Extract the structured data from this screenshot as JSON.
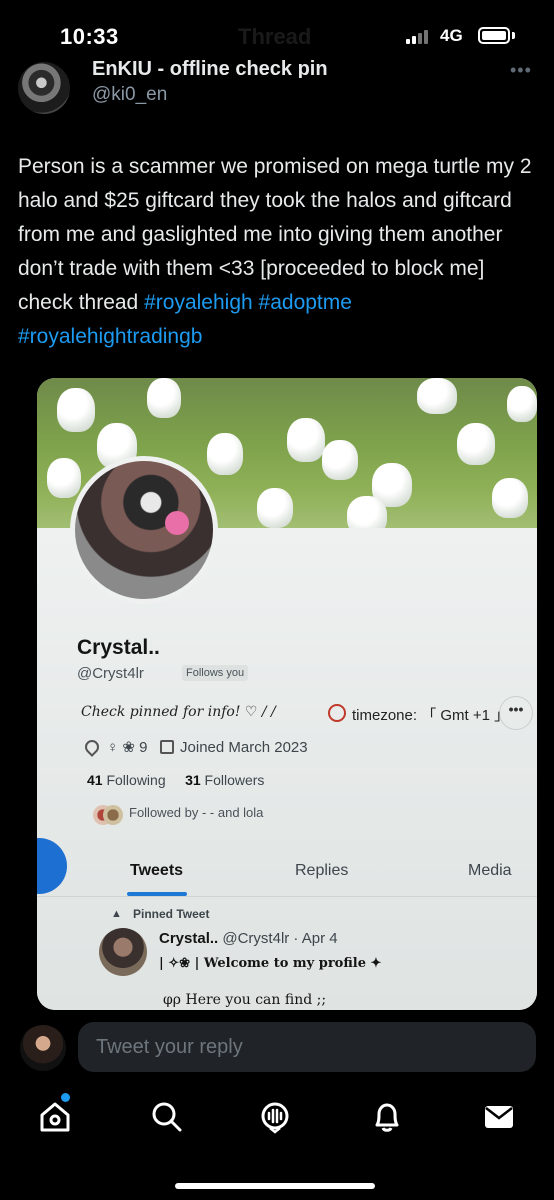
{
  "status_bar": {
    "time": "10:33",
    "network": "4G",
    "ghost_title": "Thread"
  },
  "author": {
    "name": "EnKIU - offline check pin",
    "handle": "@ki0_en",
    "more": "•••"
  },
  "tweet": {
    "text": "Person is a scammer we promised on mega turtle  my 2 halo and $25 giftcard they took the halos and giftcard from me and gaslighted me into giving them another don’t trade with them <33 [proceeded to block me] check thread",
    "hashtags": [
      "#royalehigh",
      "#adoptme",
      "#royalehightradingb"
    ]
  },
  "photo": {
    "profile_name": "Crystal..",
    "profile_handle": "@Cryst4lr",
    "follows_you": "Follows you",
    "bio": "Check pinned for info! ♡ / /",
    "timezone": "timezone: 「 Gmt +1 」",
    "meta_icons": "♀ ❀ 9",
    "joined": "Joined March 2023",
    "following_count": "41",
    "following_label": "Following",
    "followers_count": "31",
    "followers_label": "Followers",
    "followed_by": "Followed by - - and lola",
    "more": "•••",
    "tabs": [
      "Tweets",
      "Replies",
      "Media"
    ],
    "pinned_label": "Pinned Tweet",
    "pinned_name": "Crystal..",
    "pinned_meta": "@Cryst4lr · Apr 4",
    "pinned_line1": "| ✧❀ | Welcome to my profile ✦",
    "pinned_line2": "φρ Here you can find ;;"
  },
  "reply": {
    "placeholder": "Tweet your reply"
  },
  "nav": {
    "icons": [
      "home-icon",
      "search-icon",
      "spaces-icon",
      "notifications-icon",
      "messages-icon"
    ]
  },
  "colors": {
    "accent": "#1d9bf0",
    "background": "#000000",
    "reply_box": "#202327"
  }
}
